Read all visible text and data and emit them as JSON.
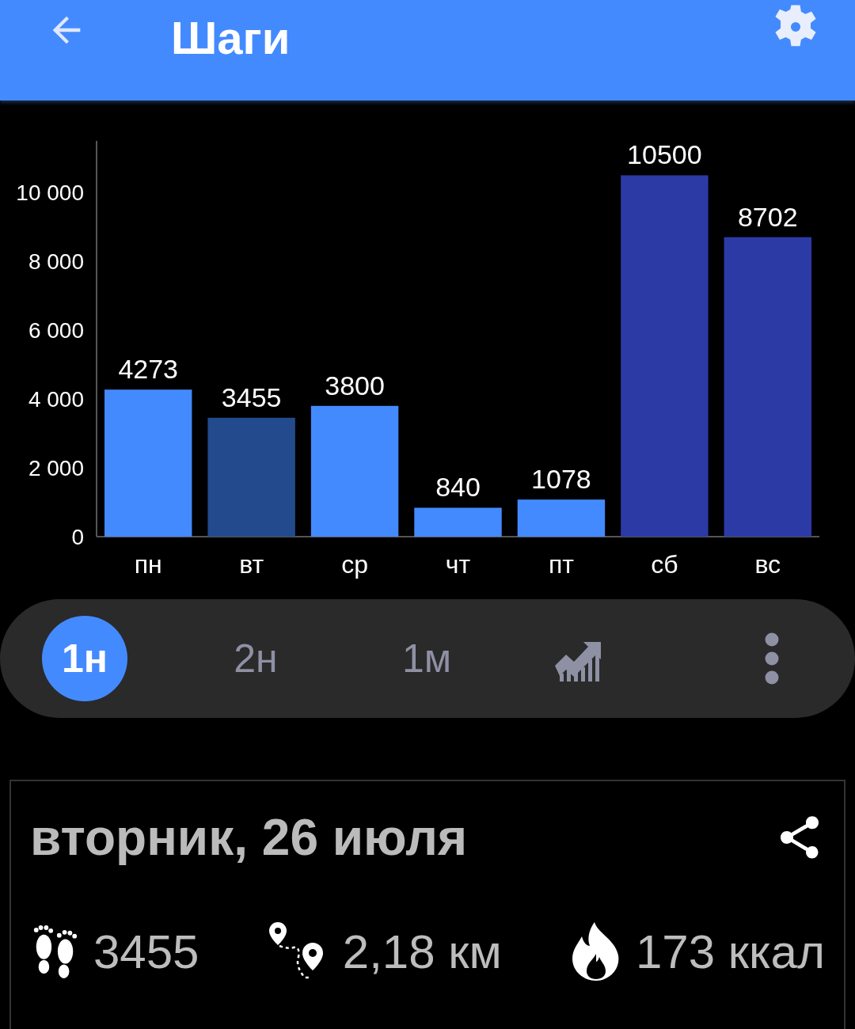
{
  "app_bar": {
    "title": "Шаги"
  },
  "chart_data": {
    "type": "bar",
    "categories": [
      "пн",
      "вт",
      "ср",
      "чт",
      "пт",
      "сб",
      "вс"
    ],
    "ylim": [
      0,
      11500
    ],
    "yticks": [
      {
        "value": 0,
        "label": "0"
      },
      {
        "value": 2000,
        "label": "2 000"
      },
      {
        "value": 4000,
        "label": "4 000"
      },
      {
        "value": 6000,
        "label": "6 000"
      },
      {
        "value": 8000,
        "label": "8 000"
      },
      {
        "value": 10000,
        "label": "10 000"
      }
    ],
    "data_labels": true,
    "series": [
      {
        "color": "#448aff",
        "values": [
          4273,
          null,
          3800,
          840,
          1078,
          null,
          null
        ]
      },
      {
        "color": "#234a8c",
        "values": [
          null,
          3455,
          null,
          null,
          null,
          null,
          null
        ]
      },
      {
        "color": "#2c3aa6",
        "values": [
          null,
          null,
          null,
          null,
          null,
          10500,
          8702
        ]
      }
    ]
  },
  "periods": [
    {
      "label": "1н",
      "selected": true
    },
    {
      "label": "2н",
      "selected": false
    },
    {
      "label": "1м",
      "selected": false
    }
  ],
  "day_card": {
    "title": "вторник, 26 июля",
    "stats": [
      {
        "kind": "steps",
        "value": "3455"
      },
      {
        "kind": "distance",
        "value": "2,18 км"
      },
      {
        "kind": "calories",
        "value": "173 ккал"
      }
    ]
  }
}
